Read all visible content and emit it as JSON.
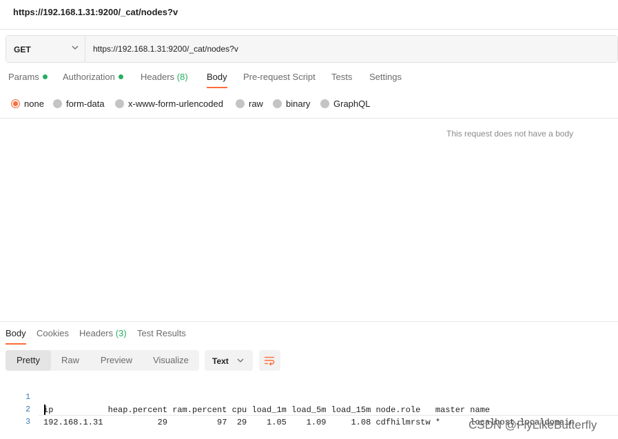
{
  "title": "https://192.168.1.31:9200/_cat/nodes?v",
  "request": {
    "method": "GET",
    "url": "https://192.168.1.31:9200/_cat/nodes?v"
  },
  "request_tabs": [
    {
      "label": "Params"
    },
    {
      "label": "Authorization"
    },
    {
      "label": "Headers",
      "count": "(8)"
    },
    {
      "label": "Body"
    },
    {
      "label": "Pre-request Script"
    },
    {
      "label": "Tests"
    },
    {
      "label": "Settings"
    }
  ],
  "body_types": [
    "none",
    "form-data",
    "x-www-form-urlencoded",
    "raw",
    "binary",
    "GraphQL"
  ],
  "selected_body_type": "none",
  "no_body_message": "This request does not have a body",
  "response_tabs": [
    {
      "label": "Body"
    },
    {
      "label": "Cookies"
    },
    {
      "label": "Headers",
      "count": "(3)"
    },
    {
      "label": "Test Results"
    }
  ],
  "view_modes": [
    "Pretty",
    "Raw",
    "Preview",
    "Visualize"
  ],
  "active_view_mode": "Pretty",
  "format": "Text",
  "response_lines": [
    {
      "num": "1",
      "text": "ip           heap.percent ram.percent cpu load_1m load_5m load_15m node.role   master name"
    },
    {
      "num": "2",
      "text": "192.168.1.31           29          97  29    1.05    1.09     1.08 cdfhilmrstw *      localhost.localdomain"
    },
    {
      "num": "3",
      "text": ""
    }
  ],
  "watermark": "CSDN @FlyLikeButterfly",
  "colors": {
    "accent": "#ff6c37",
    "status_green": "#27ae60",
    "line_number": "#3a7ab8"
  }
}
